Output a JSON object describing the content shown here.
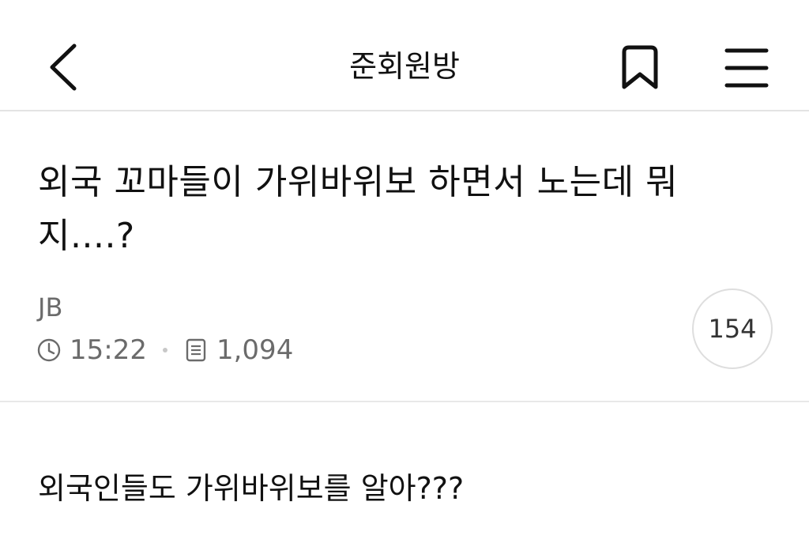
{
  "header": {
    "title": "준회원방"
  },
  "post": {
    "title": "외국 꼬마들이 가위바위보 하면서 노는데 뭐 지....?",
    "author": "JB",
    "time": "15:22",
    "views": "1,094",
    "comment_count": "154",
    "body": "외국인들도 가위바위보를 알아???"
  },
  "icons": {
    "back": "chevron-left-icon",
    "bookmark": "bookmark-icon",
    "menu": "hamburger-menu-icon",
    "time": "clock-icon",
    "views": "document-icon"
  }
}
